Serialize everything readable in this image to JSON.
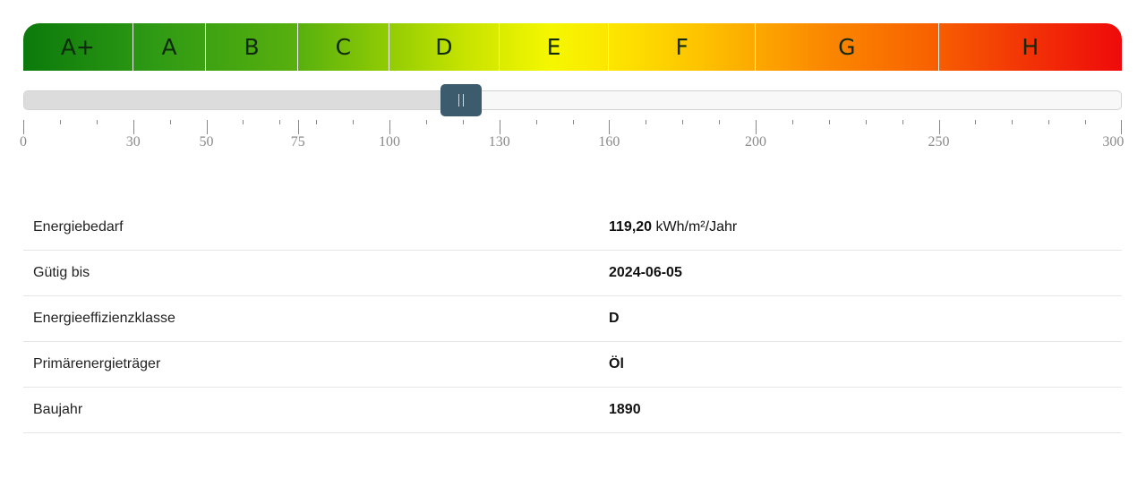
{
  "energy_scale": {
    "classes": [
      {
        "label": "A+",
        "from": 0,
        "to": 30
      },
      {
        "label": "A",
        "from": 30,
        "to": 50
      },
      {
        "label": "B",
        "from": 50,
        "to": 75
      },
      {
        "label": "C",
        "from": 75,
        "to": 100
      },
      {
        "label": "D",
        "from": 100,
        "to": 130
      },
      {
        "label": "E",
        "from": 130,
        "to": 160
      },
      {
        "label": "F",
        "from": 160,
        "to": 200
      },
      {
        "label": "G",
        "from": 200,
        "to": 250
      },
      {
        "label": "H",
        "from": 250,
        "to": 300
      }
    ],
    "min": 0,
    "max": 300,
    "value": 119.2,
    "tick_labels": [
      "0",
      "30",
      "50",
      "75",
      "100",
      "130",
      "160",
      "200",
      "250",
      "300"
    ],
    "minor_tick_step": 10
  },
  "details": [
    {
      "label": "Energiebedarf",
      "value": "119,20",
      "unit": "kWh/m²/Jahr"
    },
    {
      "label": "Gütig bis",
      "value": "2024-06-05",
      "unit": ""
    },
    {
      "label": "Energieeffizienzklasse",
      "value": "D",
      "unit": ""
    },
    {
      "label": "Primärenergieträger",
      "value": "Öl",
      "unit": ""
    },
    {
      "label": "Baujahr",
      "value": "1890",
      "unit": ""
    }
  ]
}
